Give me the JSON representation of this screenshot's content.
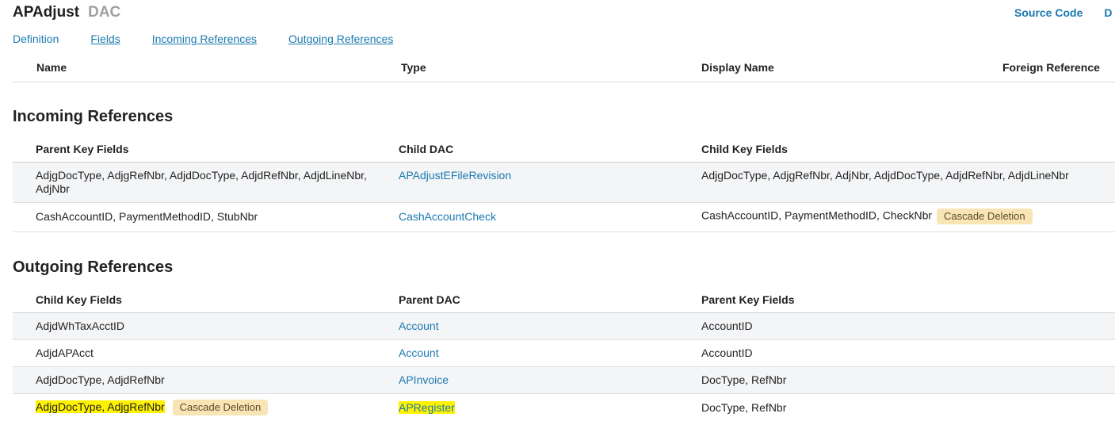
{
  "header": {
    "title": "APAdjust",
    "subtitle": "DAC",
    "source_code_link": "Source Code",
    "cut_link": "D"
  },
  "nav": {
    "definition": "Definition",
    "fields": "Fields",
    "incoming": "Incoming References",
    "outgoing": "Outgoing References"
  },
  "fields_table": {
    "headers": [
      "Name",
      "Type",
      "Display Name",
      "Foreign Reference"
    ]
  },
  "incoming": {
    "title": "Incoming References",
    "headers": [
      "Parent Key Fields",
      "Child DAC",
      "Child Key Fields"
    ],
    "rows": [
      {
        "c1": "AdjgDocType, AdjgRefNbr, AdjdDocType, AdjdRefNbr, AdjdLineNbr, AdjNbr",
        "c2": "APAdjustEFileRevision",
        "c3": "AdjgDocType, AdjgRefNbr, AdjNbr, AdjdDocType, AdjdRefNbr, AdjdLineNbr",
        "badge": ""
      },
      {
        "c1": "CashAccountID, PaymentMethodID, StubNbr",
        "c2": "CashAccountCheck",
        "c3": "CashAccountID, PaymentMethodID, CheckNbr",
        "badge": "Cascade Deletion"
      }
    ]
  },
  "outgoing": {
    "title": "Outgoing References",
    "headers": [
      "Child Key Fields",
      "Parent DAC",
      "Parent Key Fields"
    ],
    "rows": [
      {
        "c1": "AdjdWhTaxAcctID",
        "c2": "Account",
        "c3": "AccountID"
      },
      {
        "c1": "AdjdAPAcct",
        "c2": "Account",
        "c3": "AccountID"
      },
      {
        "c1": "AdjdDocType, AdjdRefNbr",
        "c2": "APInvoice",
        "c3": "DocType, RefNbr"
      },
      {
        "c1": "AdjgDocType, AdjgRefNbr",
        "c2": "APRegister",
        "c3": "DocType, RefNbr",
        "badge": "Cascade Deletion"
      }
    ]
  },
  "colors": {
    "link": "#1a79b0",
    "badge_bg": "#f8e4b4",
    "highlight": "#fff200"
  }
}
